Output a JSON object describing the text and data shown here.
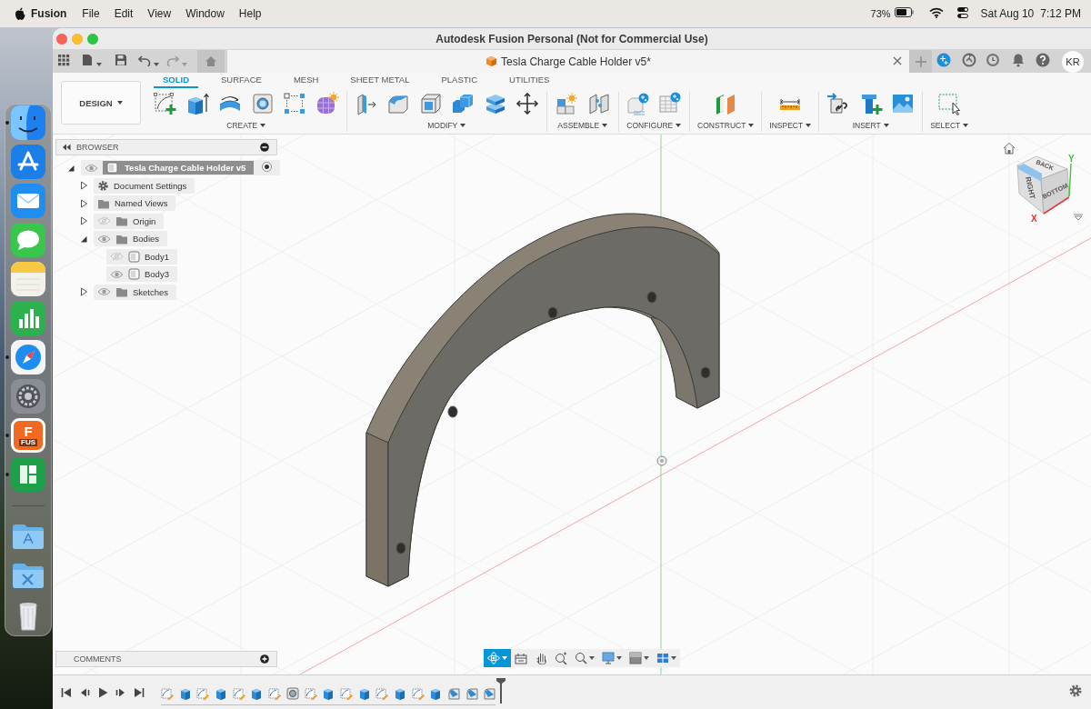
{
  "menu_bar": {
    "app": "Fusion",
    "menus": [
      "File",
      "Edit",
      "View",
      "Window",
      "Help"
    ],
    "battery": "73%",
    "date": "Sat Aug 10",
    "time": "7:12 PM"
  },
  "dock": {
    "apps": [
      {
        "kind": "finder",
        "running": true
      },
      {
        "kind": "appstore",
        "running": false
      },
      {
        "kind": "mail",
        "running": false
      },
      {
        "kind": "messages",
        "running": false
      },
      {
        "kind": "notes",
        "running": false
      },
      {
        "kind": "numbers",
        "running": false
      },
      {
        "kind": "safari",
        "running": true
      },
      {
        "kind": "settings",
        "running": false
      },
      {
        "kind": "fusion",
        "running": true,
        "label": "F",
        "caption": "FUS"
      },
      {
        "kind": "spreadsheet",
        "running": true
      }
    ],
    "stacks": [
      {
        "kind": "applications"
      },
      {
        "kind": "utilities"
      },
      {
        "kind": "trash"
      }
    ]
  },
  "window": {
    "title": "Autodesk Fusion Personal (Not for Commercial Use)"
  },
  "document_tab": {
    "title": "Tesla Charge Cable Holder v5*"
  },
  "account": {
    "initials": "KR"
  },
  "toolbar": {
    "workspace": "DESIGN",
    "tabs": [
      {
        "label": "SOLID",
        "selected": true
      },
      {
        "label": "SURFACE",
        "selected": false
      },
      {
        "label": "MESH",
        "selected": false
      },
      {
        "label": "SHEET METAL",
        "selected": false
      },
      {
        "label": "PLASTIC",
        "selected": false
      },
      {
        "label": "UTILITIES",
        "selected": false
      }
    ],
    "groups": [
      {
        "label": "CREATE"
      },
      {
        "label": "MODIFY"
      },
      {
        "label": "ASSEMBLE"
      },
      {
        "label": "CONFIGURE"
      },
      {
        "label": "CONSTRUCT"
      },
      {
        "label": "INSPECT"
      },
      {
        "label": "INSERT"
      },
      {
        "label": "SELECT"
      }
    ]
  },
  "browser": {
    "title": "BROWSER",
    "tree": [
      {
        "label": "Tesla Charge Cable Holder v5",
        "kind": "component",
        "visible": true,
        "expanded": true,
        "children": [
          {
            "label": "Document Settings",
            "kind": "settings",
            "expanded": false
          },
          {
            "label": "Named Views",
            "kind": "folder",
            "expanded": false
          },
          {
            "label": "Origin",
            "kind": "folder",
            "visible": false,
            "expanded": false
          },
          {
            "label": "Bodies",
            "kind": "folder",
            "visible": true,
            "expanded": true,
            "children": [
              {
                "label": "Body1",
                "kind": "body",
                "visible": false
              },
              {
                "label": "Body3",
                "kind": "body",
                "visible": true
              }
            ]
          },
          {
            "label": "Sketches",
            "kind": "folder",
            "visible": true,
            "expanded": false
          }
        ]
      }
    ]
  },
  "view_cube": {
    "faces": [
      "BACK",
      "RIGHT",
      "BOTTOM"
    ],
    "axes": [
      "Y",
      "X"
    ]
  },
  "comments": {
    "title": "COMMENTS"
  },
  "nav_tools": [
    {
      "kind": "orbit",
      "selected": true
    },
    {
      "kind": "lookat",
      "selected": false
    },
    {
      "kind": "pan",
      "selected": false
    },
    {
      "kind": "zoom",
      "selected": false
    },
    {
      "kind": "fit",
      "selected": false
    },
    {
      "kind": "display",
      "selected": false
    },
    {
      "kind": "style",
      "selected": false
    },
    {
      "kind": "viewports",
      "selected": false
    }
  ]
}
